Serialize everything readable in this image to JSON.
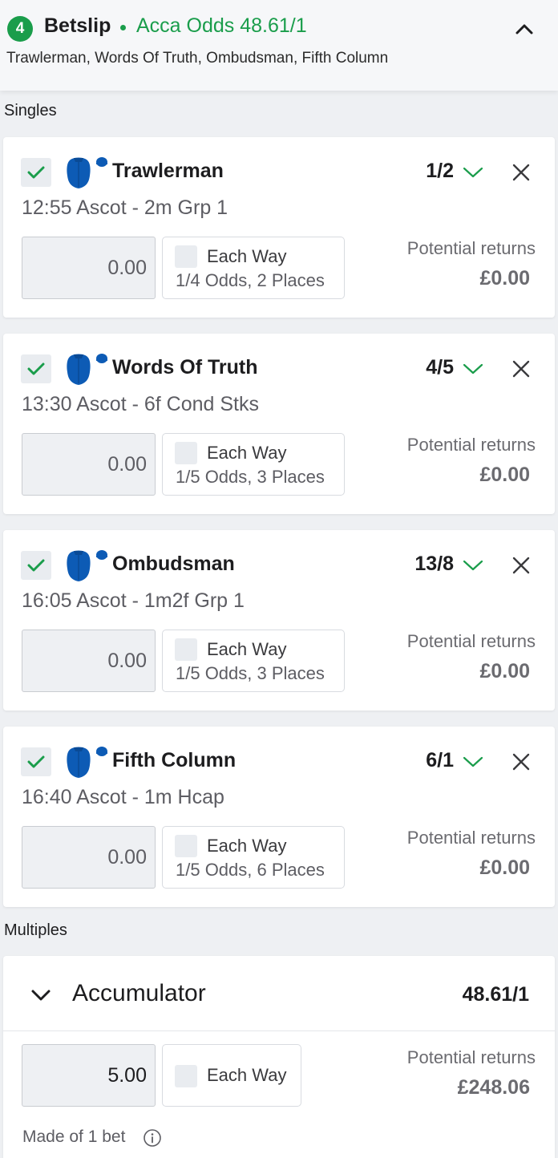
{
  "header": {
    "count": "4",
    "title": "Betslip",
    "acca_odds": "Acca Odds 48.61/1",
    "selections_summary": "Trawlerman, Words Of Truth, Ombudsman, Fifth Column"
  },
  "sections": {
    "singles": "Singles",
    "multiples": "Multiples"
  },
  "colors": {
    "accent_green": "#1a9d4b",
    "silk_blue": "#0d5bb5"
  },
  "icons": {
    "collapse": "chevron-up-icon",
    "selected": "check-icon",
    "odds_dropdown": "chevron-down-icon",
    "remove": "close-icon",
    "silk": "jockey-silk-icon",
    "info": "info-icon"
  },
  "singles": [
    {
      "runner": "Trawlerman",
      "odds": "1/2",
      "race": "12:55 Ascot - 2m Grp 1",
      "stake": "0.00",
      "each_way_label": "Each Way",
      "each_way_terms": "1/4 Odds, 2 Places",
      "returns_label": "Potential returns",
      "returns": "£0.00"
    },
    {
      "runner": "Words Of Truth",
      "odds": "4/5",
      "race": "13:30 Ascot - 6f Cond Stks",
      "stake": "0.00",
      "each_way_label": "Each Way",
      "each_way_terms": "1/5 Odds, 3 Places",
      "returns_label": "Potential returns",
      "returns": "£0.00"
    },
    {
      "runner": "Ombudsman",
      "odds": "13/8",
      "race": "16:05 Ascot - 1m2f Grp 1",
      "stake": "0.00",
      "each_way_label": "Each Way",
      "each_way_terms": "1/5 Odds, 3 Places",
      "returns_label": "Potential returns",
      "returns": "£0.00"
    },
    {
      "runner": "Fifth Column",
      "odds": "6/1",
      "race": "16:40 Ascot - 1m Hcap",
      "stake": "0.00",
      "each_way_label": "Each Way",
      "each_way_terms": "1/5 Odds, 6 Places",
      "returns_label": "Potential returns",
      "returns": "£0.00"
    }
  ],
  "accumulator": {
    "title": "Accumulator",
    "odds": "48.61/1",
    "stake": "5.00",
    "each_way_label": "Each Way",
    "returns_label": "Potential returns",
    "returns": "£248.06",
    "made_of": "Made of 1 bet"
  }
}
